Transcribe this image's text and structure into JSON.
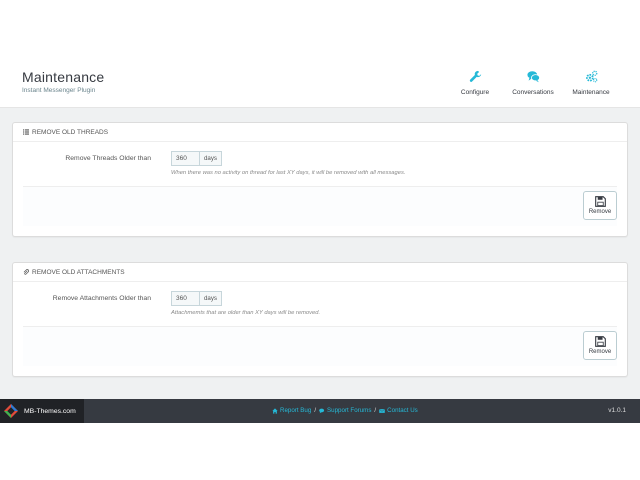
{
  "header": {
    "title": "Maintenance",
    "subtitle": "Instant Messenger Plugin",
    "toolbar": [
      {
        "label": "Configure",
        "icon": "wrench-icon"
      },
      {
        "label": "Conversations",
        "icon": "chat-bubbles-icon"
      },
      {
        "label": "Maintenance",
        "icon": "cogs-icon"
      }
    ]
  },
  "panels": [
    {
      "heading": "REMOVE OLD THREADS",
      "heading_icon": "list-icon",
      "label": "Remove Threads Older than",
      "value": "360",
      "addon": "days",
      "help": "When there was no activity on thread for last XY days, it will be removed with all messages.",
      "button": "Remove"
    },
    {
      "heading": "REMOVE OLD ATTACHMENTS",
      "heading_icon": "paperclip-icon",
      "label": "Remove Attachments Older than",
      "value": "360",
      "addon": "days",
      "help": "Attachmemts that are older than XY days will be removed.",
      "button": "Remove"
    }
  ],
  "footer": {
    "brand": "MB-Themes.com",
    "links": [
      {
        "label": "Report Bug",
        "icon": "home-icon"
      },
      {
        "label": "Support Forums",
        "icon": "comments-icon"
      },
      {
        "label": "Contact Us",
        "icon": "envelope-icon"
      }
    ],
    "separator": "/",
    "version": "v1.0.1"
  },
  "colors": {
    "accent": "#25b9d7",
    "footer_bg": "#363a41",
    "main_bg": "#eff1f2"
  }
}
